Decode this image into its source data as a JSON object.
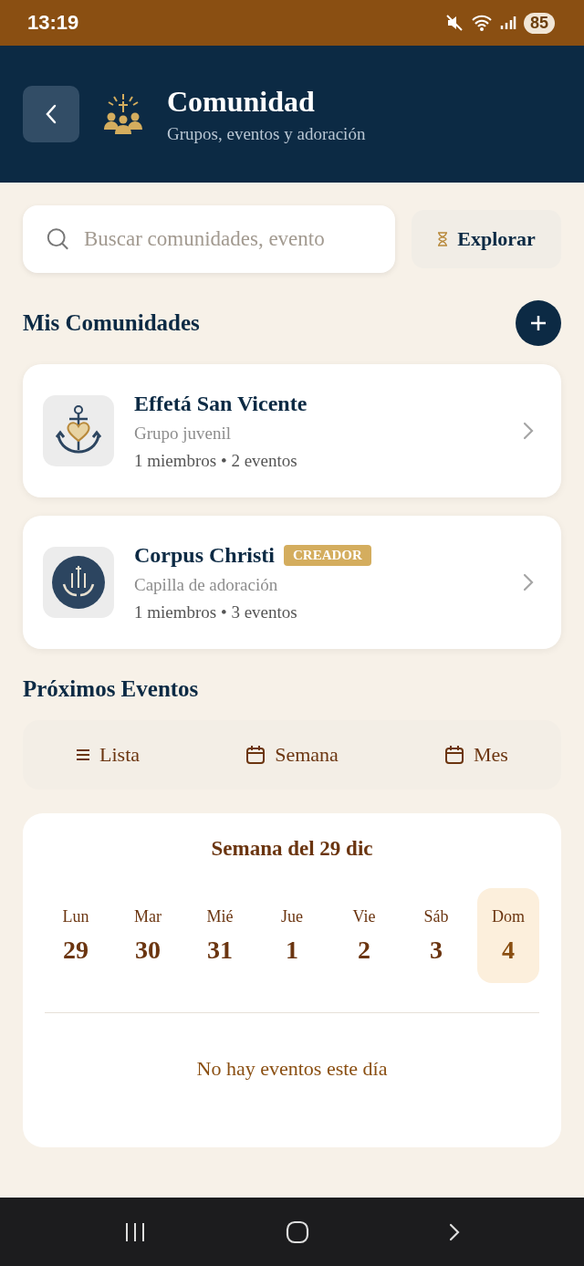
{
  "status_bar": {
    "time": "13:19",
    "battery": "85"
  },
  "header": {
    "title": "Comunidad",
    "subtitle": "Grupos, eventos y adoración"
  },
  "search": {
    "placeholder": "Buscar comunidades, evento",
    "explore_button": "Explorar"
  },
  "my_communities": {
    "title": "Mis Comunidades",
    "items": [
      {
        "name": "Effetá San Vicente",
        "kind": "anchor",
        "type": "Grupo juvenil",
        "stats": "1 miembros • 2 eventos"
      },
      {
        "name": "Corpus Christi",
        "badge": "CREADOR",
        "kind": "hands",
        "type": "Capilla de adoración",
        "stats": "1 miembros • 3 eventos"
      }
    ]
  },
  "events": {
    "title": "Próximos Eventos",
    "views": [
      {
        "label": "Lista",
        "kind": "list",
        "selected": false
      },
      {
        "label": "Semana",
        "kind": "calendar",
        "selected": false
      },
      {
        "label": "Mes",
        "kind": "calendar",
        "selected": false
      }
    ],
    "week": {
      "title": "Semana del 29 dic",
      "days": [
        {
          "name": "Lun",
          "date": "29",
          "selected": false
        },
        {
          "name": "Mar",
          "date": "30",
          "selected": false
        },
        {
          "name": "Mié",
          "date": "31",
          "selected": false
        },
        {
          "name": "Jue",
          "date": "1",
          "selected": false
        },
        {
          "name": "Vie",
          "date": "2",
          "selected": false
        },
        {
          "name": "Sáb",
          "date": "3",
          "selected": false
        },
        {
          "name": "Dom",
          "date": "4",
          "selected": true
        }
      ],
      "empty": "No hay eventos este día"
    }
  }
}
